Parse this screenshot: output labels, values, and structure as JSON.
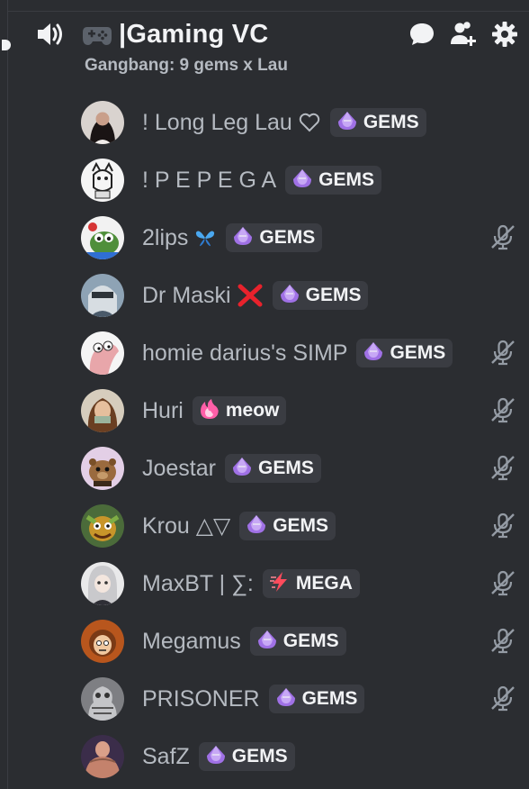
{
  "header": {
    "speaker_icon": "speaker-icon",
    "emoji_icon": "video-game-controller-icon",
    "channel_name": "|Gaming VC",
    "status": "Gangbang: 9 gems x Lau",
    "actions": [
      "chat-bubble-icon",
      "add-user-icon",
      "gear-icon"
    ]
  },
  "members": [
    {
      "name": "! Long Leg Lau",
      "deco": "white-heart-outline",
      "tag": "GEMS",
      "tag_icon": "purple-gem-icon",
      "muted": false
    },
    {
      "name": "! P E P E G A",
      "deco": "",
      "tag": "GEMS",
      "tag_icon": "purple-gem-icon",
      "muted": false
    },
    {
      "name": "2lips",
      "deco": "blue-butterfly",
      "tag": "GEMS",
      "tag_icon": "purple-gem-icon",
      "muted": true
    },
    {
      "name": "Dr Maski",
      "deco": "red-x",
      "tag": "GEMS",
      "tag_icon": "purple-gem-icon",
      "muted": false
    },
    {
      "name": "homie darius's SIMP",
      "deco": "",
      "tag": "GEMS",
      "tag_icon": "purple-gem-icon",
      "muted": true
    },
    {
      "name": "Huri",
      "deco": "",
      "tag": "meow",
      "tag_icon": "pink-flame-icon",
      "muted": true
    },
    {
      "name": "Joestar",
      "deco": "",
      "tag": "GEMS",
      "tag_icon": "purple-gem-icon",
      "muted": true
    },
    {
      "name": "Krou △▽",
      "deco": "",
      "tag": "GEMS",
      "tag_icon": "purple-gem-icon",
      "muted": true
    },
    {
      "name": "MaxBT | ∑:",
      "deco": "",
      "tag": "MEGA",
      "tag_icon": "lightning-icon",
      "muted": true
    },
    {
      "name": "Megamus",
      "deco": "",
      "tag": "GEMS",
      "tag_icon": "purple-gem-icon",
      "muted": true
    },
    {
      "name": "PRISONER",
      "deco": "",
      "tag": "GEMS",
      "tag_icon": "purple-gem-icon",
      "muted": true
    },
    {
      "name": "SafZ",
      "deco": "",
      "tag": "GEMS",
      "tag_icon": "purple-gem-icon",
      "muted": false
    }
  ],
  "colors": {
    "background": "#2b2d31",
    "name_text": "#b5bac1",
    "header_text": "#f2f3f5",
    "tag_bg": "#3a3c42",
    "gem_purple": "#a071e6",
    "mute_gray": "#949ba4"
  }
}
